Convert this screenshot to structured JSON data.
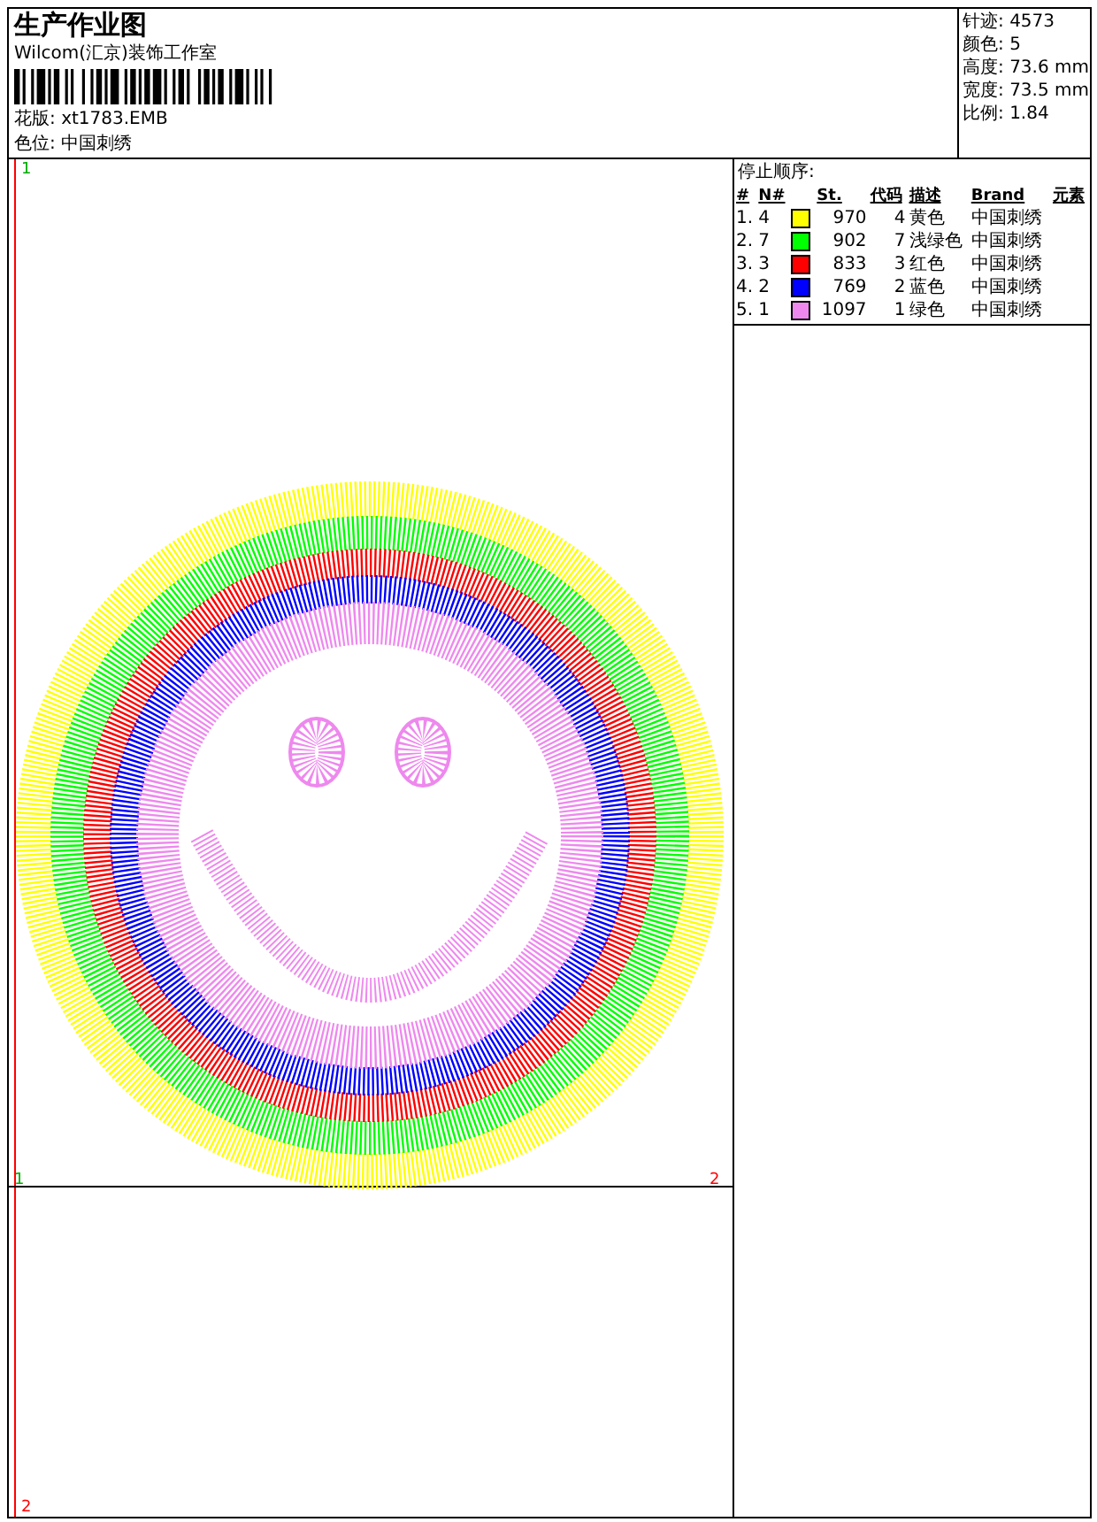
{
  "header": {
    "title": "生产作业图",
    "company": "Wilcom(汇京)装饰工作室",
    "design_label": "花版:",
    "design_file": "xt1783.EMB",
    "colorway_label": "色位:",
    "colorway": "中国刺绣"
  },
  "stats": [
    {
      "label": "针迹:",
      "value": "4573"
    },
    {
      "label": "颜色:",
      "value": "5"
    },
    {
      "label": "高度:",
      "value": "73.6 mm"
    },
    {
      "label": "宽度:",
      "value": "73.5 mm"
    },
    {
      "label": "比例:",
      "value": "1.84"
    }
  ],
  "stop_sequence": {
    "title": "停止顺序:",
    "columns": [
      "#",
      "N#",
      "St.",
      "代码",
      "描述",
      "Brand",
      "元素"
    ],
    "rows": [
      {
        "seq": "1.",
        "needle": "4",
        "color": "#ffff00",
        "stitches": "970",
        "code": "4",
        "description": "黄色",
        "brand": "中国刺绣"
      },
      {
        "seq": "2.",
        "needle": "7",
        "color": "#00ff00",
        "stitches": "902",
        "code": "7",
        "description": "浅绿色",
        "brand": "中国刺绣"
      },
      {
        "seq": "3.",
        "needle": "3",
        "color": "#ff0000",
        "stitches": "833",
        "code": "3",
        "description": "红色",
        "brand": "中国刺绣"
      },
      {
        "seq": "4.",
        "needle": "2",
        "color": "#0000ff",
        "stitches": "769",
        "code": "2",
        "description": "蓝色",
        "brand": "中国刺绣"
      },
      {
        "seq": "5.",
        "needle": "1",
        "color": "#ee88ee",
        "stitches": "1097",
        "code": "1",
        "description": "绿色",
        "brand": "中国刺绣"
      }
    ]
  },
  "canvas_markers": {
    "top_left": {
      "text": "1",
      "color": "#00aa00"
    },
    "mid_left": {
      "text": "1",
      "color": "#00aa00"
    },
    "mid_right": {
      "text": "2",
      "color": "#ff0000"
    },
    "bottom_left": {
      "text": "2",
      "color": "#ff0000"
    }
  }
}
